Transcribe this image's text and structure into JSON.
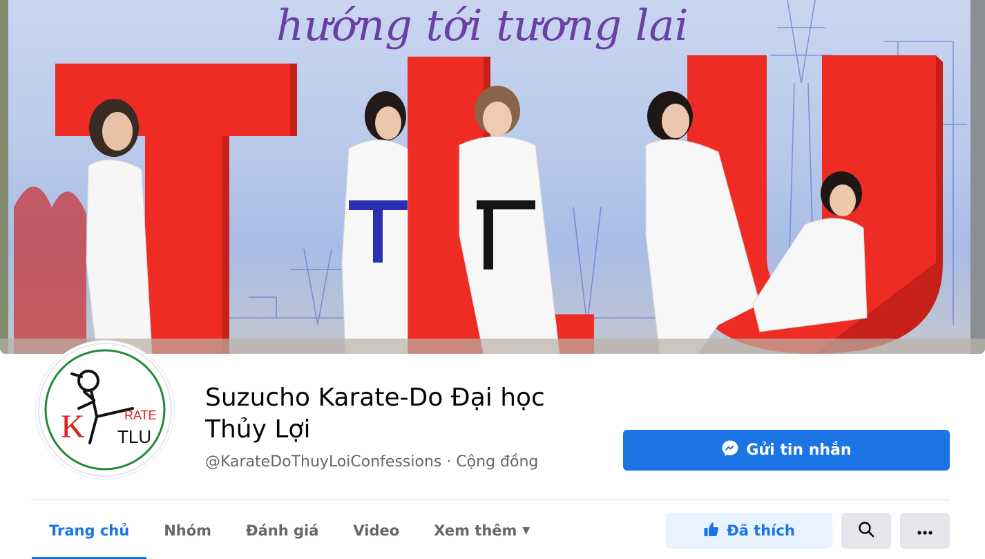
{
  "cover": {
    "banner_text": "hướng tới tương lai",
    "letters": [
      "T",
      "L",
      "U"
    ]
  },
  "avatar": {
    "letter_k": "K",
    "word_rate": "RATE",
    "word_tlu": "TLU"
  },
  "page": {
    "name": "Suzucho Karate-Do Đại học Thủy Lợi",
    "meta": "@KarateDoThuyLoiConfessions · Cộng đồng"
  },
  "actions": {
    "message_label": "Gửi tin nhắn",
    "like_label": "Đã thích"
  },
  "tabs": [
    {
      "label": "Trang chủ",
      "active": true
    },
    {
      "label": "Nhóm"
    },
    {
      "label": "Đánh giá"
    },
    {
      "label": "Video"
    },
    {
      "label": "Xem thêm"
    }
  ],
  "colors": {
    "accent": "#1b74e4",
    "accent_light": "#e7f3ff",
    "secondary_text": "#65676b",
    "tlu_red": "#ee2c24"
  },
  "icons": {
    "messenger": "messenger-icon",
    "like": "thumbs-up-icon",
    "search": "search-icon",
    "more": "more-dots-icon",
    "dropdown": "caret-down-icon"
  }
}
